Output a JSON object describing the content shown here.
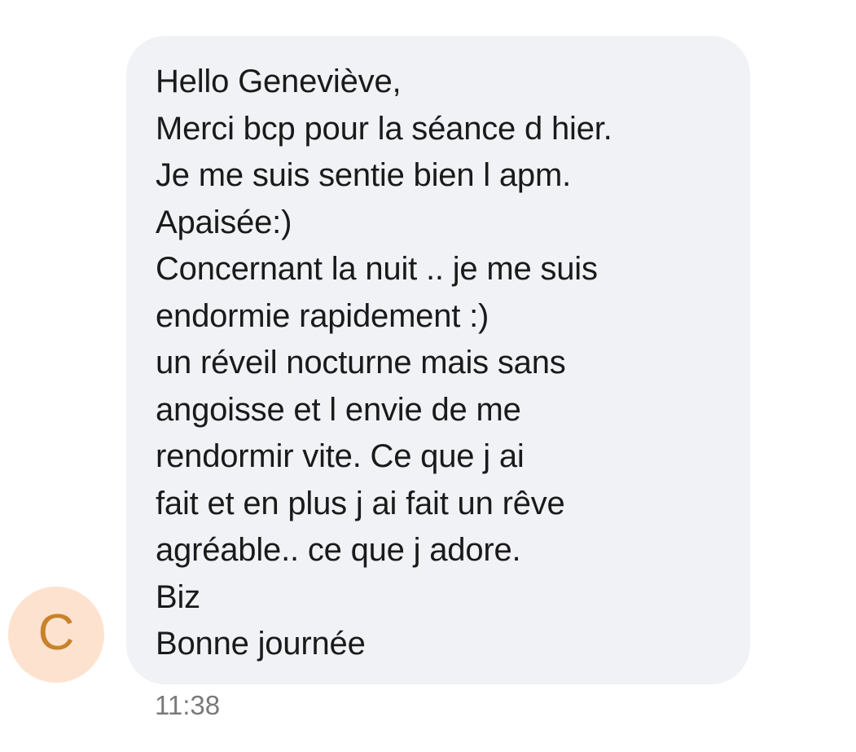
{
  "contact": {
    "avatar_letter": "C",
    "avatar_bg": "#fde3cf",
    "avatar_fg": "#c8832a"
  },
  "message": {
    "lines": [
      "Hello Geneviève,",
      "Merci bcp pour la séance d hier.",
      "Je me suis sentie bien l apm.",
      "Apaisée:)",
      "Concernant la nuit .. je me suis",
      "endormie rapidement :)",
      "un réveil nocturne mais sans",
      "angoisse et l envie de me",
      "rendormir vite. Ce que j ai",
      "fait et en plus j ai fait un rêve",
      "agréable.. ce que j adore.",
      "Biz",
      "Bonne journée"
    ],
    "time": "11:38",
    "bubble_color": "#f1f2f6"
  }
}
